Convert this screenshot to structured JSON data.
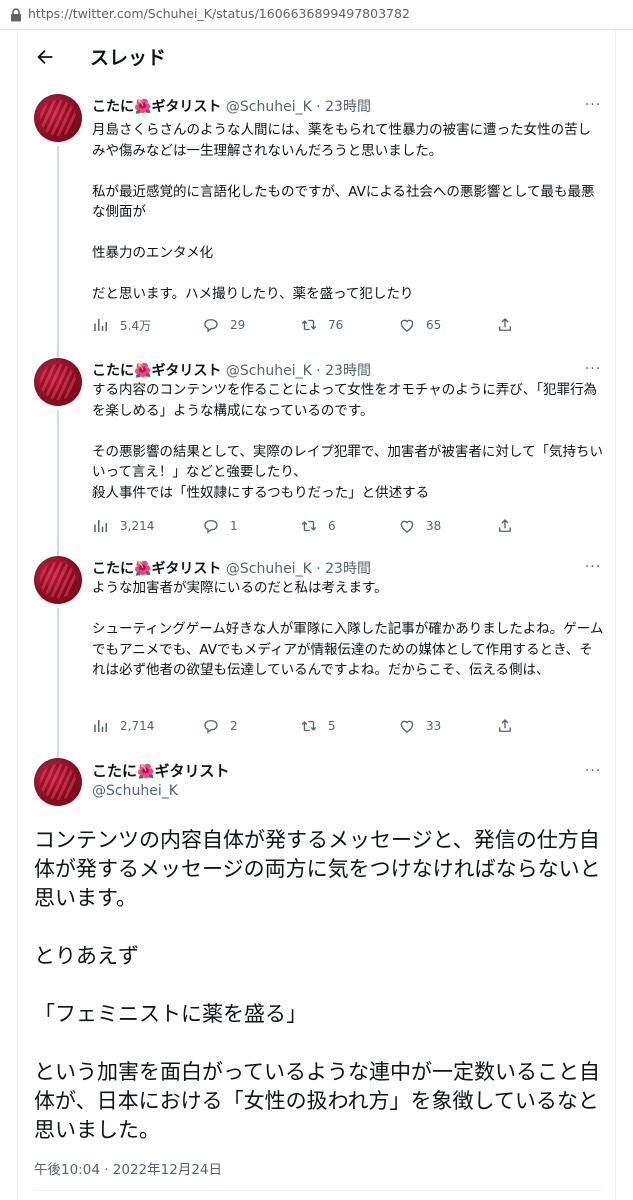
{
  "browser": {
    "url": "https://twitter.com/Schuhei_K/status/1606636899497803782"
  },
  "header": {
    "title": "スレッド"
  },
  "tweets": [
    {
      "name": "こたに",
      "flower": "🌺",
      "name_suffix": "ギタリスト",
      "meta": "@Schuhei_K · 23時間",
      "text": "月島さくらさんのような人間には、薬をもられて性暴力の被害に遭った女性の苦しみや傷みなどは一生理解されないんだろうと思いました。\n\n私が最近感覚的に言語化したものですが、AVによる社会への悪影響として最も最悪な側面が\n\n性暴力のエンタメ化\n\nだと思います。ハメ撮りしたり、薬を盛って犯したり",
      "views": "5.4万",
      "replies": "29",
      "retweets": "76",
      "likes": "65"
    },
    {
      "name": "こたに",
      "flower": "🌺",
      "name_suffix": "ギタリスト",
      "meta": "@Schuhei_K · 23時間",
      "text": "する内容のコンテンツを作ることによって女性をオモチャのように弄び、「犯罪行為を楽しめる」ような構成になっているのです。\n\nその悪影響の結果として、実際のレイプ犯罪で、加害者が被害者に対して「気持ちいいって言え！」などと強要したり、\n殺人事件では「性奴隷にするつもりだった」と供述する",
      "views": "3,214",
      "replies": "1",
      "retweets": "6",
      "likes": "38"
    },
    {
      "name": "こたに",
      "flower": "🌺",
      "name_suffix": "ギタリスト",
      "meta": "@Schuhei_K · 23時間",
      "text": "ような加害者が実際にいるのだと私は考えます。\n\nシューティングゲーム好きな人が軍隊に入隊した記事が確かありましたよね。ゲームでもアニメでも、AVでもメディアが情報伝達のための媒体として作用するとき、それは必ず他者の欲望も伝達しているんですよね。だからこそ、伝える側は、",
      "views": "2,714",
      "replies": "2",
      "retweets": "5",
      "likes": "33"
    }
  ],
  "main_tweet": {
    "name": "こたに",
    "flower": "🌺",
    "name_suffix": "ギタリスト",
    "handle": "@Schuhei_K",
    "text": "コンテンツの内容自体が発するメッセージと、発信の仕方自体が発するメッセージの両方に気をつけなければならないと思います。\n\nとりあえず\n\n「フェミニストに薬を盛る」\n\nという加害を面白がっているような連中が一定数いること自体が、日本における「女性の扱われ方」を象徴しているなと思いました。",
    "timestamp": "午後10:04 · 2022年12月24日"
  },
  "icons": [
    "lock-icon",
    "back-arrow-icon",
    "more-icon",
    "views-icon",
    "reply-icon",
    "retweet-icon",
    "like-icon",
    "share-icon"
  ],
  "colors": {
    "text": "#0f1419",
    "secondary": "#536471",
    "thread_line": "#cfd9de",
    "avatar": "#b0142c"
  }
}
